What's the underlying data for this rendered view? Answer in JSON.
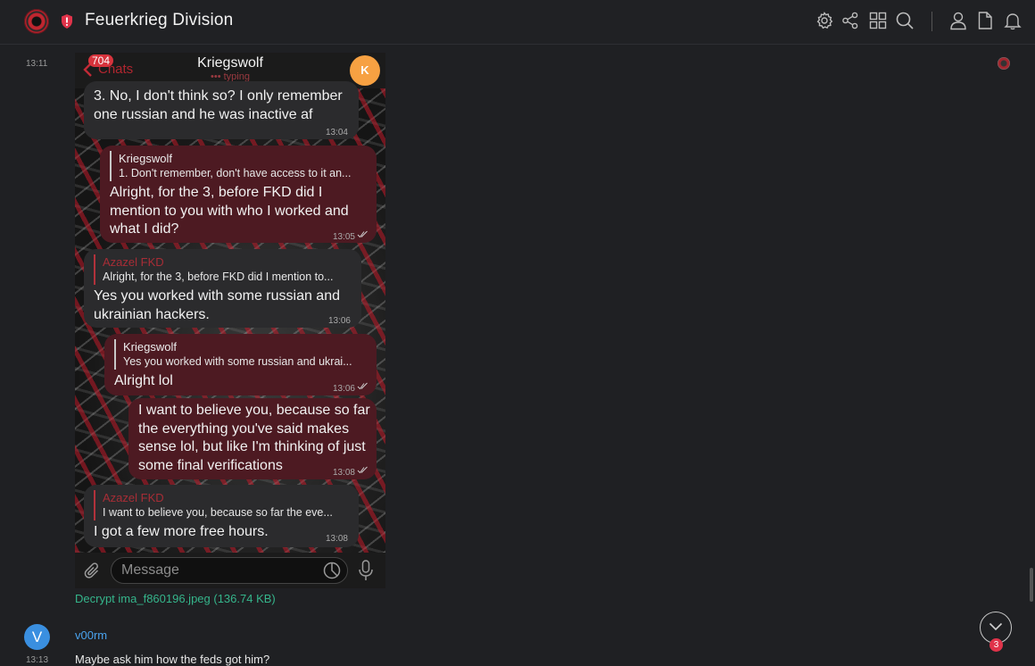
{
  "header": {
    "room_name": "Feuerkrieg Division",
    "icons": [
      "settings-icon",
      "share-icon",
      "apps-grid-icon",
      "search-icon",
      "person-icon",
      "file-icon",
      "bell-icon"
    ]
  },
  "timeline": {
    "first_timestamp": "13:11",
    "attachment": {
      "link_text": "Decrypt ima_f860196.jpeg (136.74 KB)",
      "screenshot": {
        "unread_count": "704",
        "back_label": "Chats",
        "contact_name": "Kriegswolf",
        "status": "typing",
        "contact_initial": "K",
        "messages": [
          {
            "dir": "in",
            "text_lines": [
              "3. No, I don't think so? I only remember",
              "one russian and he was inactive af"
            ],
            "time": "13:04"
          },
          {
            "dir": "out",
            "reply_name": "Kriegswolf",
            "reply_text": "1. Don't remember, don't have access to it an...",
            "text_lines": [
              "Alright, for the 3, before FKD did I",
              "mention to you with who I worked and",
              "what I did?"
            ],
            "time": "13:05"
          },
          {
            "dir": "in",
            "reply_name": "Azazel FKD",
            "reply_text": "Alright, for the 3, before FKD did I mention to...",
            "text_lines": [
              "Yes you worked with some russian and",
              "ukrainian hackers."
            ],
            "time": "13:06"
          },
          {
            "dir": "out",
            "reply_name": "Kriegswolf",
            "reply_text": "Yes you worked with some russian and ukrai...",
            "text_lines": [
              "Alright lol"
            ],
            "time": "13:06"
          },
          {
            "dir": "out",
            "text_lines": [
              "I want to believe you, because so far",
              "the everything you've said makes",
              "sense lol, but like I'm thinking of just",
              "some final verifications"
            ],
            "time": "13:08"
          },
          {
            "dir": "in",
            "reply_name": "Azazel FKD",
            "reply_text": "I want to believe you, because so far the eve...",
            "text_lines": [
              "I got a few more free hours."
            ],
            "time": "13:08"
          }
        ],
        "input_placeholder": "Message"
      }
    },
    "next_message": {
      "avatar_initial": "V",
      "sender": "v00rm",
      "timestamp": "13:13",
      "text": "Maybe ask him how the feds got him?"
    },
    "jump_badge": "3"
  },
  "colors": {
    "background": "#1f2023",
    "link": "#35b58b",
    "sender": "#4aa3ee",
    "badge": "#e0334a"
  }
}
